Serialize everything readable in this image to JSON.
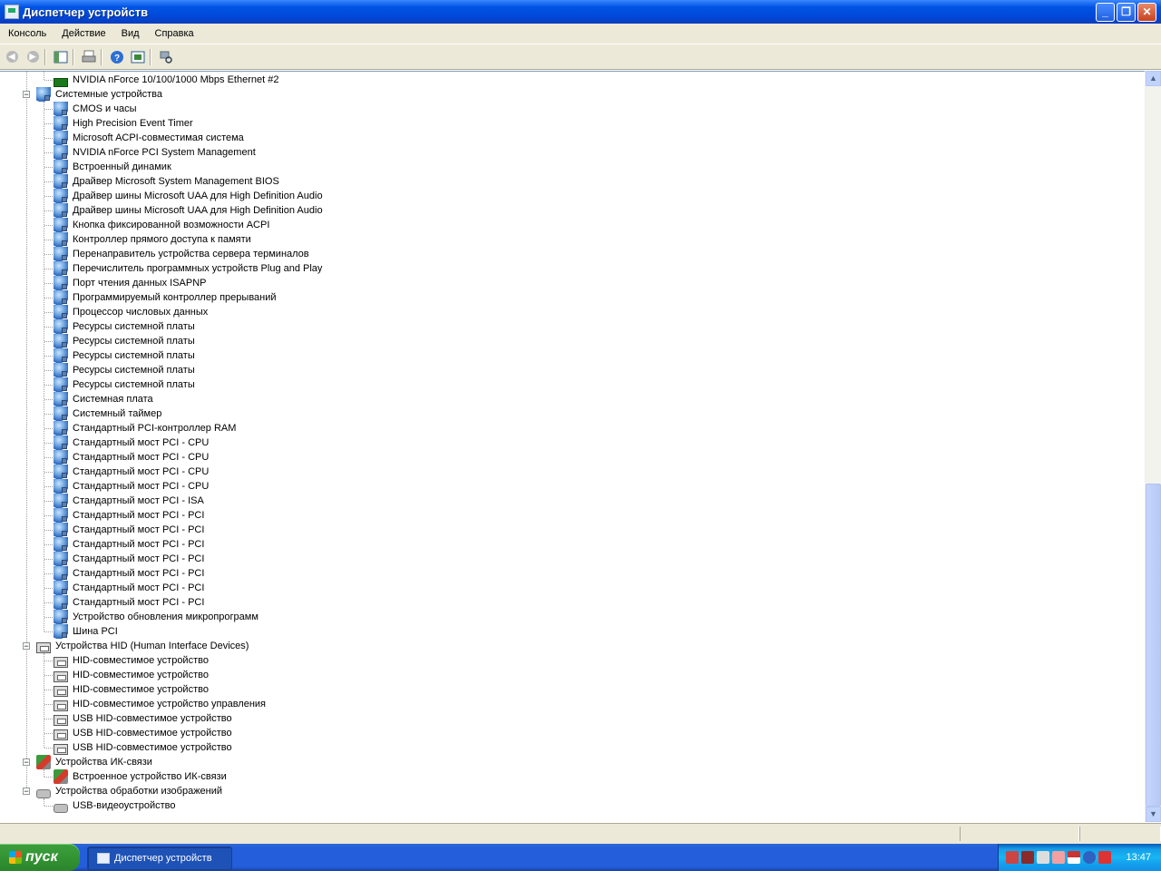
{
  "window": {
    "title": "Диспетчер устройств"
  },
  "menu": [
    "Консоль",
    "Действие",
    "Вид",
    "Справка"
  ],
  "tree": [
    {
      "level": 2,
      "icon": "network",
      "label": "NVIDIA nForce 10/100/1000 Mbps Ethernet #2"
    },
    {
      "level": 1,
      "icon": "system",
      "label": "Системные устройства",
      "expanded": true
    },
    {
      "level": 2,
      "icon": "system",
      "label": "CMOS и часы"
    },
    {
      "level": 2,
      "icon": "system",
      "label": "High Precision Event Timer"
    },
    {
      "level": 2,
      "icon": "system",
      "label": "Microsoft ACPI-совместимая система"
    },
    {
      "level": 2,
      "icon": "system",
      "label": "NVIDIA nForce PCI System Management"
    },
    {
      "level": 2,
      "icon": "system",
      "label": "Встроенный динамик"
    },
    {
      "level": 2,
      "icon": "system",
      "label": "Драйвер Microsoft System Management BIOS"
    },
    {
      "level": 2,
      "icon": "system",
      "label": "Драйвер шины Microsoft UAA для High Definition Audio"
    },
    {
      "level": 2,
      "icon": "system",
      "label": "Драйвер шины Microsoft UAA для High Definition Audio"
    },
    {
      "level": 2,
      "icon": "system",
      "label": "Кнопка фиксированной возможности ACPI"
    },
    {
      "level": 2,
      "icon": "system",
      "label": "Контроллер прямого доступа к памяти"
    },
    {
      "level": 2,
      "icon": "system",
      "label": "Перенаправитель устройства сервера терминалов"
    },
    {
      "level": 2,
      "icon": "system",
      "label": "Перечислитель программных устройств Plug and Play"
    },
    {
      "level": 2,
      "icon": "system",
      "label": "Порт чтения данных ISAPNP"
    },
    {
      "level": 2,
      "icon": "system",
      "label": "Программируемый контроллер прерываний"
    },
    {
      "level": 2,
      "icon": "system",
      "label": "Процессор числовых данных"
    },
    {
      "level": 2,
      "icon": "system",
      "label": "Ресурсы системной платы"
    },
    {
      "level": 2,
      "icon": "system",
      "label": "Ресурсы системной платы"
    },
    {
      "level": 2,
      "icon": "system",
      "label": "Ресурсы системной платы"
    },
    {
      "level": 2,
      "icon": "system",
      "label": "Ресурсы системной платы"
    },
    {
      "level": 2,
      "icon": "system",
      "label": "Ресурсы системной платы"
    },
    {
      "level": 2,
      "icon": "system",
      "label": "Системная плата"
    },
    {
      "level": 2,
      "icon": "system",
      "label": "Системный таймер"
    },
    {
      "level": 2,
      "icon": "system",
      "label": "Стандартный PCI-контроллер RAM"
    },
    {
      "level": 2,
      "icon": "system",
      "label": "Стандартный мост PCI  - CPU"
    },
    {
      "level": 2,
      "icon": "system",
      "label": "Стандартный мост PCI  - CPU"
    },
    {
      "level": 2,
      "icon": "system",
      "label": "Стандартный мост PCI  - CPU"
    },
    {
      "level": 2,
      "icon": "system",
      "label": "Стандартный мост PCI  - CPU"
    },
    {
      "level": 2,
      "icon": "system",
      "label": "Стандартный мост PCI - ISA"
    },
    {
      "level": 2,
      "icon": "system",
      "label": "Стандартный мост PCI - PCI"
    },
    {
      "level": 2,
      "icon": "system",
      "label": "Стандартный мост PCI - PCI"
    },
    {
      "level": 2,
      "icon": "system",
      "label": "Стандартный мост PCI - PCI"
    },
    {
      "level": 2,
      "icon": "system",
      "label": "Стандартный мост PCI - PCI"
    },
    {
      "level": 2,
      "icon": "system",
      "label": "Стандартный мост PCI - PCI"
    },
    {
      "level": 2,
      "icon": "system",
      "label": "Стандартный мост PCI - PCI"
    },
    {
      "level": 2,
      "icon": "system",
      "label": "Стандартный мост PCI - PCI"
    },
    {
      "level": 2,
      "icon": "system",
      "label": "Устройство обновления микропрограмм"
    },
    {
      "level": 2,
      "icon": "system",
      "label": "Шина PCI"
    },
    {
      "level": 1,
      "icon": "hid",
      "label": "Устройства HID (Human Interface Devices)",
      "expanded": true
    },
    {
      "level": 2,
      "icon": "hid",
      "label": "HID-совместимое устройство"
    },
    {
      "level": 2,
      "icon": "hid",
      "label": "HID-совместимое устройство"
    },
    {
      "level": 2,
      "icon": "hid",
      "label": "HID-совместимое устройство"
    },
    {
      "level": 2,
      "icon": "hid",
      "label": "HID-совместимое устройство управления"
    },
    {
      "level": 2,
      "icon": "hid",
      "label": "USB HID-совместимое устройство"
    },
    {
      "level": 2,
      "icon": "hid",
      "label": "USB HID-совместимое устройство"
    },
    {
      "level": 2,
      "icon": "hid",
      "label": "USB HID-совместимое устройство"
    },
    {
      "level": 1,
      "icon": "infrared",
      "label": "Устройства ИК-связи",
      "expanded": true
    },
    {
      "level": 2,
      "icon": "infrared",
      "label": "Встроенное устройство ИК-связи"
    },
    {
      "level": 1,
      "icon": "imaging",
      "label": "Устройства обработки изображений",
      "expanded": true
    },
    {
      "level": 2,
      "icon": "imaging",
      "label": "USB-видеоустройство"
    }
  ],
  "taskbar": {
    "start_label": "пуск",
    "task_label": "Диспетчер устройств",
    "clock": "13:47"
  }
}
